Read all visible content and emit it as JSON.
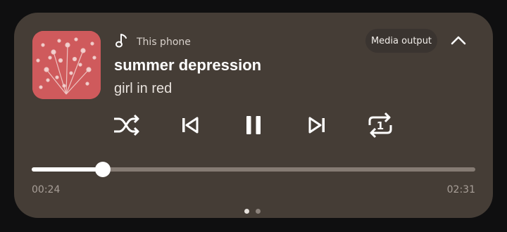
{
  "player": {
    "source_label": "This phone",
    "media_output_label": "Media output",
    "title": "summer depression",
    "artist": "girl in red",
    "elapsed": "00:24",
    "duration": "02:31",
    "progress": 0.16,
    "repeat_mode": "1"
  },
  "icons": {
    "source": "music-note-icon",
    "collapse": "chevron-up-icon",
    "shuffle": "shuffle-icon",
    "previous": "skip-previous-icon",
    "play_pause": "pause-icon",
    "next": "skip-next-icon",
    "repeat": "repeat-one-icon"
  },
  "pager": {
    "count": 2,
    "active": 0
  },
  "colors": {
    "card": "#453d36",
    "background": "#0f0f10",
    "art": "#cf5a5c",
    "track": "#857b73",
    "progress": "#ffffff",
    "dot_active": "#e6e1dc",
    "dot_inactive": "#8c837c"
  }
}
